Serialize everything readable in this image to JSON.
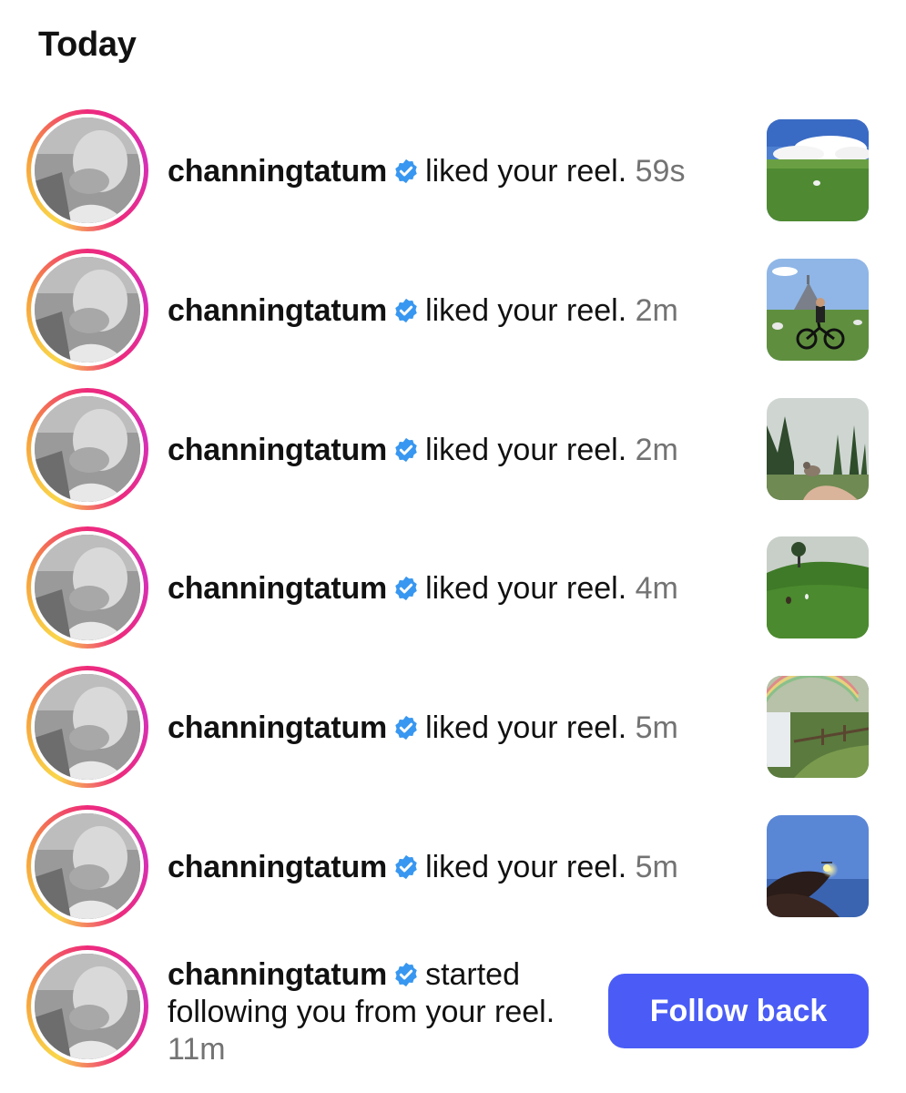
{
  "section": {
    "title": "Today"
  },
  "notifications": [
    {
      "username": "channingtatum",
      "action": "liked your reel.",
      "time": "59s",
      "thumb": "sheep-field-clouds"
    },
    {
      "username": "channingtatum",
      "action": "liked your reel.",
      "time": "2m",
      "thumb": "cyclist-mont-saint-michel"
    },
    {
      "username": "channingtatum",
      "action": "liked your reel.",
      "time": "2m",
      "thumb": "bird-on-hand-forest"
    },
    {
      "username": "channingtatum",
      "action": "liked your reel.",
      "time": "4m",
      "thumb": "green-hill-animals"
    },
    {
      "username": "channingtatum",
      "action": "liked your reel.",
      "time": "5m",
      "thumb": "rainbow-waterfall-path"
    },
    {
      "username": "channingtatum",
      "action": "liked your reel.",
      "time": "5m",
      "thumb": "firefly-hand-blue-sky"
    }
  ],
  "follow_notification": {
    "username": "channingtatum",
    "action": "started following you from your reel.",
    "time": "11m",
    "button_label": "Follow back"
  },
  "colors": {
    "verified_badge": "#3897f0",
    "follow_button": "#4a5cf5",
    "time_text": "#737373"
  },
  "icons": {
    "verified": "verified-badge-icon"
  }
}
